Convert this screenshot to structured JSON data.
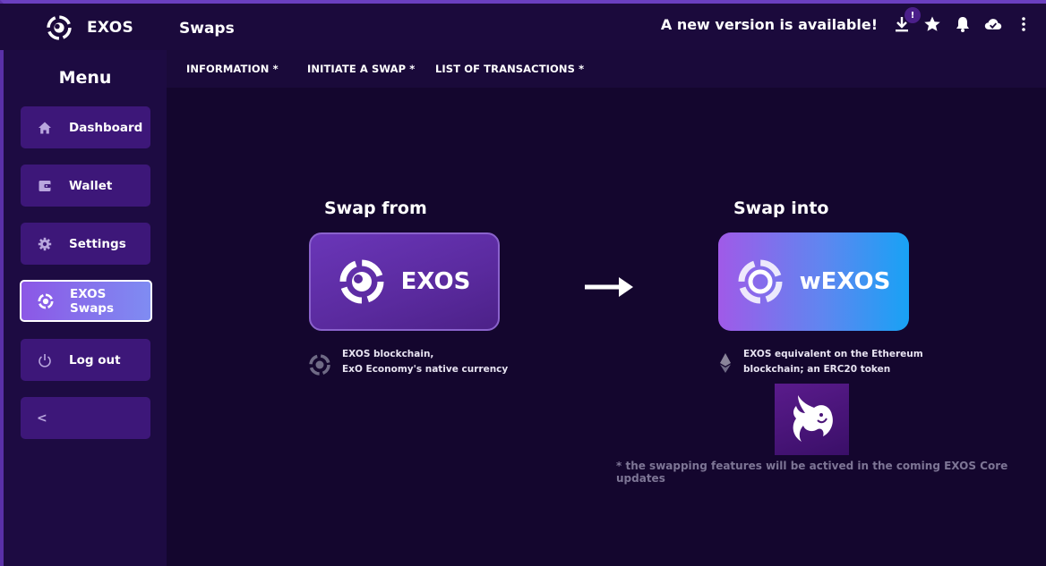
{
  "app": {
    "name": "EXOS",
    "page_title": "Swaps"
  },
  "topbar": {
    "update_message": "A new version is available!",
    "update_badge": "!",
    "icons": [
      "download-icon",
      "star-icon",
      "bell-icon",
      "cloud-check-icon",
      "more-vertical-icon"
    ]
  },
  "tabs": [
    {
      "label": "INFORMATION *"
    },
    {
      "label": "INITIATE A SWAP *"
    },
    {
      "label": "LIST OF TRANSACTIONS *"
    }
  ],
  "sidebar": {
    "title": "Menu",
    "items": [
      {
        "label": "Dashboard",
        "icon": "home-icon"
      },
      {
        "label": "Wallet",
        "icon": "wallet-icon"
      },
      {
        "label": "Settings",
        "icon": "gear-icon"
      },
      {
        "label": "EXOS Swaps",
        "icon": "exos-icon",
        "active": true
      },
      {
        "label": "Log out",
        "icon": "power-icon"
      }
    ],
    "collapse_glyph": "<"
  },
  "swap": {
    "from_label": "Swap from",
    "into_label": "Swap into",
    "from_token": "EXOS",
    "into_token": "wEXOS",
    "from_desc_line1": "EXOS blockchain,",
    "from_desc_line2": "ExO Economy's native currency",
    "into_desc_line1": "EXOS equivalent on the Ethereum",
    "into_desc_line2": "blockchain; an ERC20 token",
    "note": "* the swapping features will be actived in the coming EXOS Core updates"
  },
  "colors": {
    "background": "#14062e",
    "sidebar": "#1d0b42",
    "nav_item": "#3d1779",
    "accent_from": "#5a2a9e",
    "accent_into": "#18a2f5"
  }
}
